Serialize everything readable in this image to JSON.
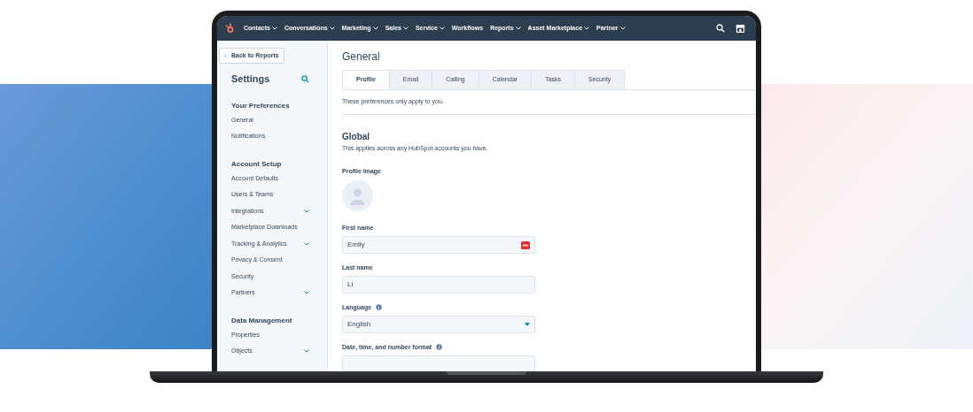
{
  "nav": {
    "items": [
      {
        "label": "Contacts",
        "caret": true
      },
      {
        "label": "Conversations",
        "caret": true
      },
      {
        "label": "Marketing",
        "caret": true
      },
      {
        "label": "Sales",
        "caret": true
      },
      {
        "label": "Service",
        "caret": true
      },
      {
        "label": "Workflows",
        "caret": false
      },
      {
        "label": "Reports",
        "caret": true
      },
      {
        "label": "Asset Marketplace",
        "caret": true
      },
      {
        "label": "Partner",
        "caret": true
      }
    ]
  },
  "sidebar": {
    "back_button": "Back to Reports",
    "title": "Settings",
    "sections": [
      {
        "heading": "Your Preferences",
        "items": [
          {
            "label": "General",
            "kind": "link"
          },
          {
            "label": "Notifications",
            "kind": "link"
          }
        ]
      },
      {
        "heading": "Account Setup",
        "items": [
          {
            "label": "Account Defaults",
            "kind": "link"
          },
          {
            "label": "Users & Teams",
            "kind": "link"
          },
          {
            "label": "Integrations",
            "kind": "group"
          },
          {
            "label": "Marketplace Downloads",
            "kind": "link"
          },
          {
            "label": "Tracking & Analytics",
            "kind": "group"
          },
          {
            "label": "Privacy & Consent",
            "kind": "link"
          },
          {
            "label": "Security",
            "kind": "link"
          },
          {
            "label": "Partners",
            "kind": "group"
          }
        ]
      },
      {
        "heading": "Data Management",
        "items": [
          {
            "label": "Properties",
            "kind": "link"
          },
          {
            "label": "Objects",
            "kind": "group"
          }
        ]
      }
    ]
  },
  "main": {
    "title": "General",
    "tabs": [
      {
        "label": "Profile",
        "selected": true
      },
      {
        "label": "Email",
        "selected": false
      },
      {
        "label": "Calling",
        "selected": false
      },
      {
        "label": "Calendar",
        "selected": false
      },
      {
        "label": "Tasks",
        "selected": false
      },
      {
        "label": "Security",
        "selected": false
      }
    ],
    "note": "These preferences only apply to you.",
    "section_title": "Global",
    "section_description": "This applies across any HubSpot accounts you have.",
    "profile_image_label": "Profile Image",
    "fields": [
      {
        "label": "First name",
        "kind": "text",
        "value": "Emily",
        "info": false,
        "badge": true
      },
      {
        "label": "Last name",
        "kind": "text",
        "value": "Li",
        "info": false,
        "badge": false
      },
      {
        "label": "Language",
        "kind": "select",
        "value": "English",
        "info": true,
        "badge": false
      },
      {
        "label": "Date, time, and number format",
        "kind": "select",
        "info": true,
        "badge": false
      }
    ]
  }
}
